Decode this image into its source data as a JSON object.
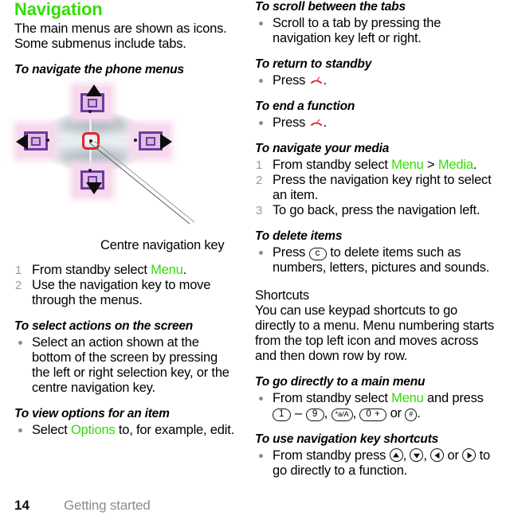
{
  "colors": {
    "link_green": "#33dd00",
    "title_green": "#33dd00",
    "list_number_gray": "#9a9a9a",
    "footer_gray": "#8c8c8c",
    "end_call_red": "#e3232e",
    "centre_key_red": "#e3232e"
  },
  "left_column": {
    "chapter_title": "Navigation",
    "intro": "The main menus are shown as icons. Some submenus include tabs.",
    "section_navigate": {
      "heading": "To navigate the phone menus",
      "illustration": {
        "caption": "Centre navigation key",
        "keys": [
          "up-key",
          "down-key",
          "left-key",
          "right-key",
          "centre-key"
        ]
      },
      "steps": [
        {
          "num": "1",
          "pre": "From standby select ",
          "link": "Menu",
          "post": "."
        },
        {
          "num": "2",
          "pre": "Use the navigation key to move through the menus.",
          "link": "",
          "post": ""
        }
      ]
    },
    "section_select_actions": {
      "heading": "To select actions on the screen",
      "bullets": [
        "Select an action shown at the bottom of the screen by pressing the left or right selection key, or the centre navigation key."
      ]
    },
    "section_view_options": {
      "heading": "To view options for an item",
      "bullet_pre": "Select ",
      "bullet_link": "Options",
      "bullet_post": " to, for example, edit."
    }
  },
  "right_column": {
    "section_scroll_tabs": {
      "heading": "To scroll between the tabs",
      "bullet": "Scroll to a tab by pressing the navigation key left or right."
    },
    "section_return_standby": {
      "heading": "To return to standby",
      "bullet_pre": "Press ",
      "bullet_icon": "end-call-icon",
      "bullet_post": "."
    },
    "section_end_function": {
      "heading": "To end a function",
      "bullet_pre": "Press ",
      "bullet_icon": "end-call-icon",
      "bullet_post": "."
    },
    "section_navigate_media": {
      "heading": "To navigate your media",
      "steps": [
        {
          "num": "1",
          "pre": "From standby select ",
          "link1": "Menu",
          "mid": " > ",
          "link2": "Media",
          "post": "."
        },
        {
          "num": "2",
          "pre": "Press the navigation key right to select an item.",
          "link1": "",
          "mid": "",
          "link2": "",
          "post": ""
        },
        {
          "num": "3",
          "pre": "To go back, press the navigation left.",
          "link1": "",
          "mid": "",
          "link2": "",
          "post": ""
        }
      ]
    },
    "section_delete_items": {
      "heading": "To delete items",
      "bullet_pre": "Press ",
      "bullet_key": "c",
      "bullet_post": " to delete items such as numbers, letters, pictures and sounds."
    },
    "section_shortcuts": {
      "heading": "Shortcuts",
      "body": "You can use keypad shortcuts to go directly to a menu. Menu numbering starts from the top left icon and moves across and then down row by row."
    },
    "section_go_directly": {
      "heading": "To go directly to a main menu",
      "bullet_pre": "From standby select ",
      "bullet_link": "Menu",
      "bullet_mid": " and press ",
      "key_1": "1",
      "key_dash": "–",
      "key_9": "9",
      "key_star": "*a/A",
      "key_zero": "0 +",
      "key_or": " or ",
      "key_hash": "#",
      "bullet_end": "."
    },
    "section_nav_shortcuts": {
      "heading": "To use navigation key shortcuts",
      "bullet_pre": "From standby press ",
      "nav_up": "nav-up-icon",
      "nav_down": "nav-down-icon",
      "nav_left": "nav-left-icon",
      "nav_or": " or ",
      "nav_right": "nav-right-icon",
      "bullet_post": " to go directly to a function."
    }
  },
  "footer": {
    "page_number": "14",
    "section": "Getting started"
  }
}
